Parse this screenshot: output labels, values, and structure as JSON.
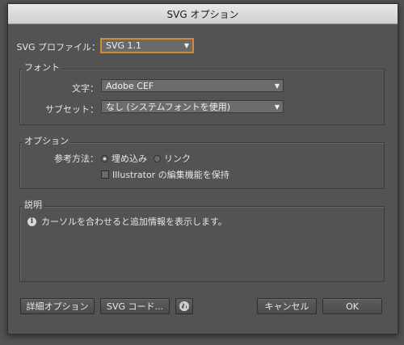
{
  "window": {
    "title": "SVG オプション"
  },
  "profile": {
    "label": "SVG プロファイル：",
    "value": "SVG 1.1"
  },
  "font_group": {
    "title": "フォント",
    "type_label": "文字：",
    "type_value": "Adobe CEF",
    "subset_label": "サブセット：",
    "subset_value": "なし (システムフォントを使用)"
  },
  "options_group": {
    "title": "オプション",
    "method_label": "参考方法：",
    "radio_embed": "埋め込み",
    "radio_link": "リンク",
    "embed_selected": true,
    "checkbox_label": "Illustrator の編集機能を保持",
    "checkbox_checked": false
  },
  "description_group": {
    "title": "説明",
    "text": "カーソルを合わせると追加情報を表示します。"
  },
  "buttons": {
    "advanced": "詳細オプション",
    "svg_code": "SVG コード...",
    "cancel": "キャンセル",
    "ok": "OK"
  },
  "icons": {
    "info": "info-icon",
    "globe": "globe-icon",
    "dropdown": "chevron-down-icon"
  }
}
